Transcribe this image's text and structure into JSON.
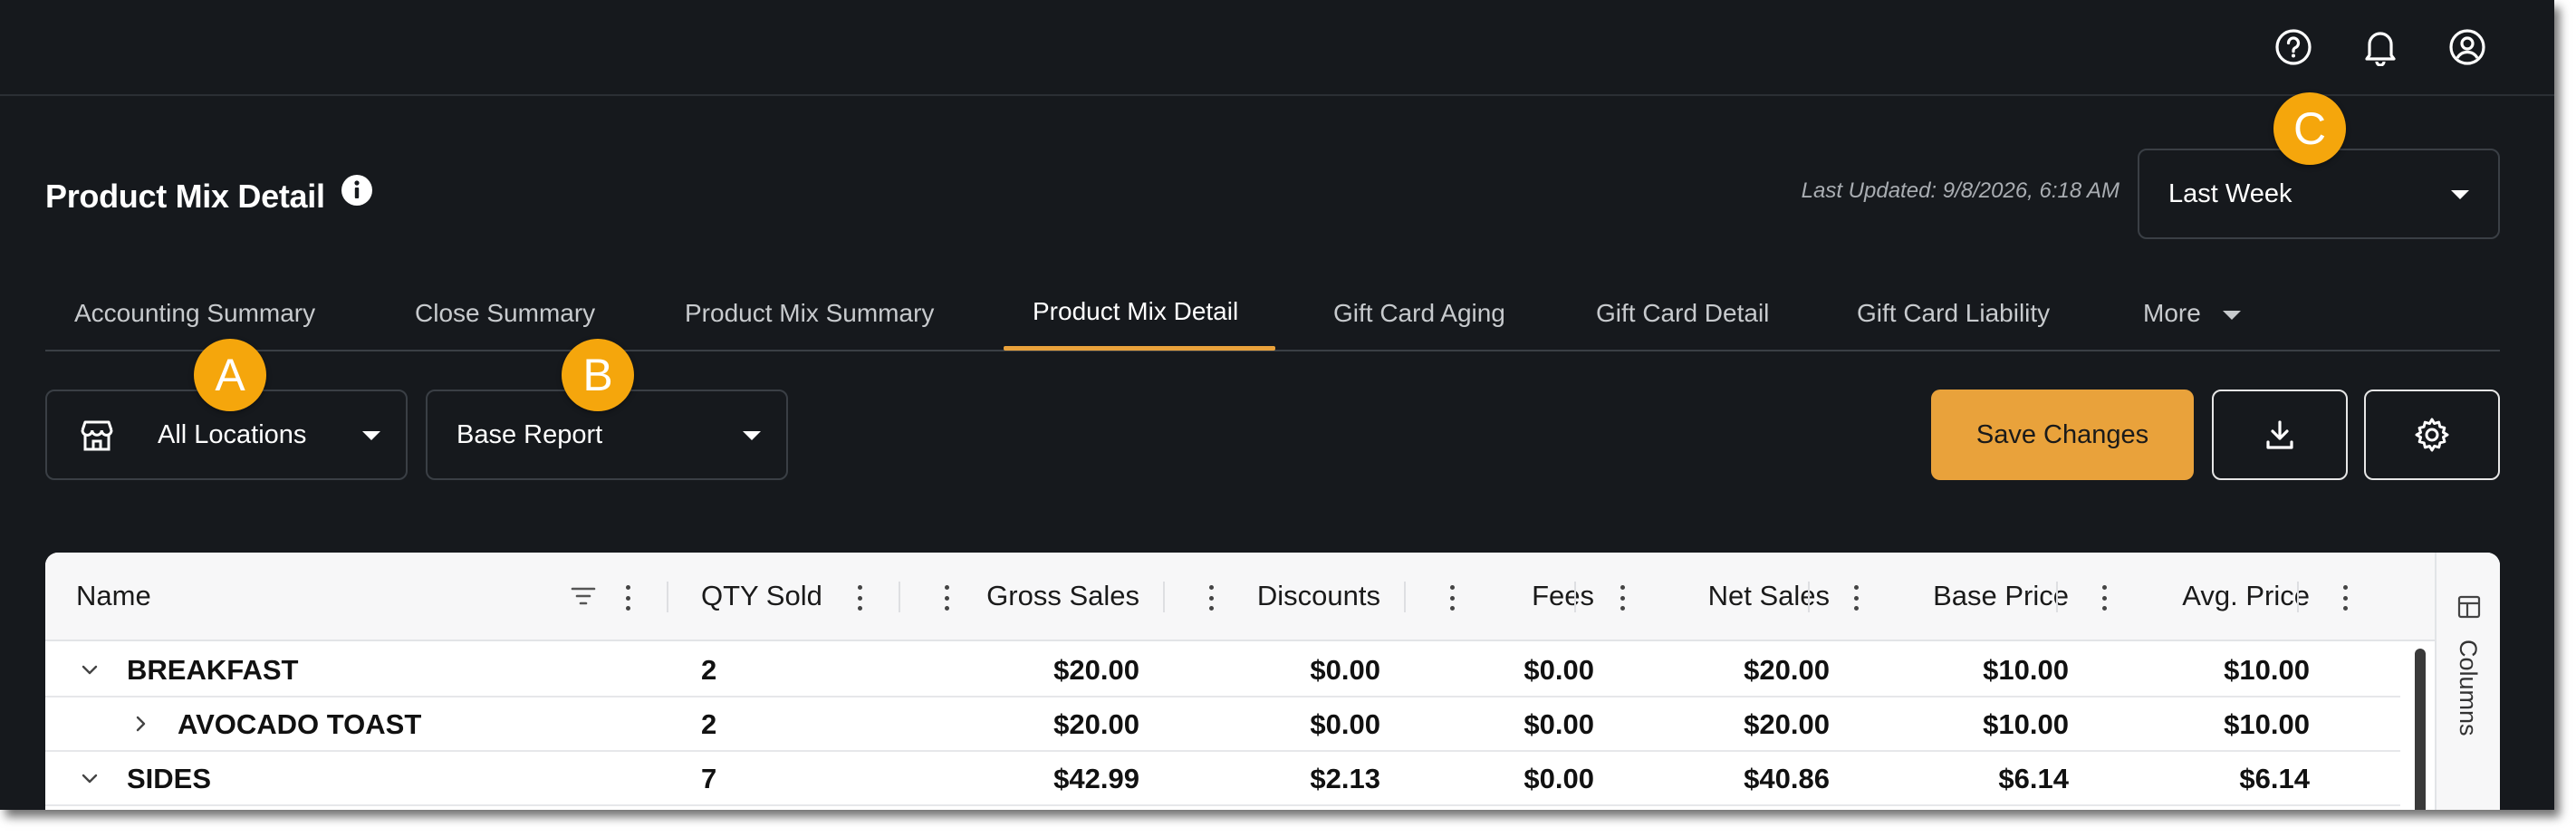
{
  "header": {
    "title": "Product Mix Detail",
    "last_updated": "Last Updated: 9/8/2026, 6:18 AM",
    "date_range": "Last Week"
  },
  "topbar": {
    "icons": [
      "help-icon",
      "notifications-bell-icon",
      "account-icon"
    ]
  },
  "tabs": [
    {
      "label": "Accounting Summary",
      "active": false
    },
    {
      "label": "Close Summary",
      "active": false
    },
    {
      "label": "Product Mix Summary",
      "active": false
    },
    {
      "label": "Product Mix Detail",
      "active": true
    },
    {
      "label": "Gift Card Aging",
      "active": false
    },
    {
      "label": "Gift Card Detail",
      "active": false
    },
    {
      "label": "Gift Card Liability",
      "active": false
    },
    {
      "label": "More",
      "active": false
    }
  ],
  "filters": {
    "location": "All Locations",
    "report": "Base Report"
  },
  "actions": {
    "save_label": "Save Changes"
  },
  "callouts": {
    "a": "A",
    "b": "B",
    "c": "C"
  },
  "table": {
    "columns": [
      "Name",
      "QTY Sold",
      "Gross Sales",
      "Discounts",
      "Fees",
      "Net Sales",
      "Base Price",
      "Avg. Price"
    ],
    "rows": [
      {
        "name": "BREAKFAST",
        "level": 0,
        "expanded": true,
        "qty": "2",
        "gross": "$20.00",
        "discounts": "$0.00",
        "fees": "$0.00",
        "net": "$20.00",
        "base": "$10.00",
        "avg": "$10.00"
      },
      {
        "name": "AVOCADO TOAST",
        "level": 1,
        "expanded": false,
        "qty": "2",
        "gross": "$20.00",
        "discounts": "$0.00",
        "fees": "$0.00",
        "net": "$20.00",
        "base": "$10.00",
        "avg": "$10.00"
      },
      {
        "name": "SIDES",
        "level": 0,
        "expanded": true,
        "qty": "7",
        "gross": "$42.99",
        "discounts": "$2.13",
        "fees": "$0.00",
        "net": "$40.86",
        "base": "$6.14",
        "avg": "$6.14"
      }
    ],
    "side_panel_label": "Columns"
  },
  "colors": {
    "background": "#16191d",
    "accent": "#e9a23b",
    "callout": "#f5a60c"
  }
}
